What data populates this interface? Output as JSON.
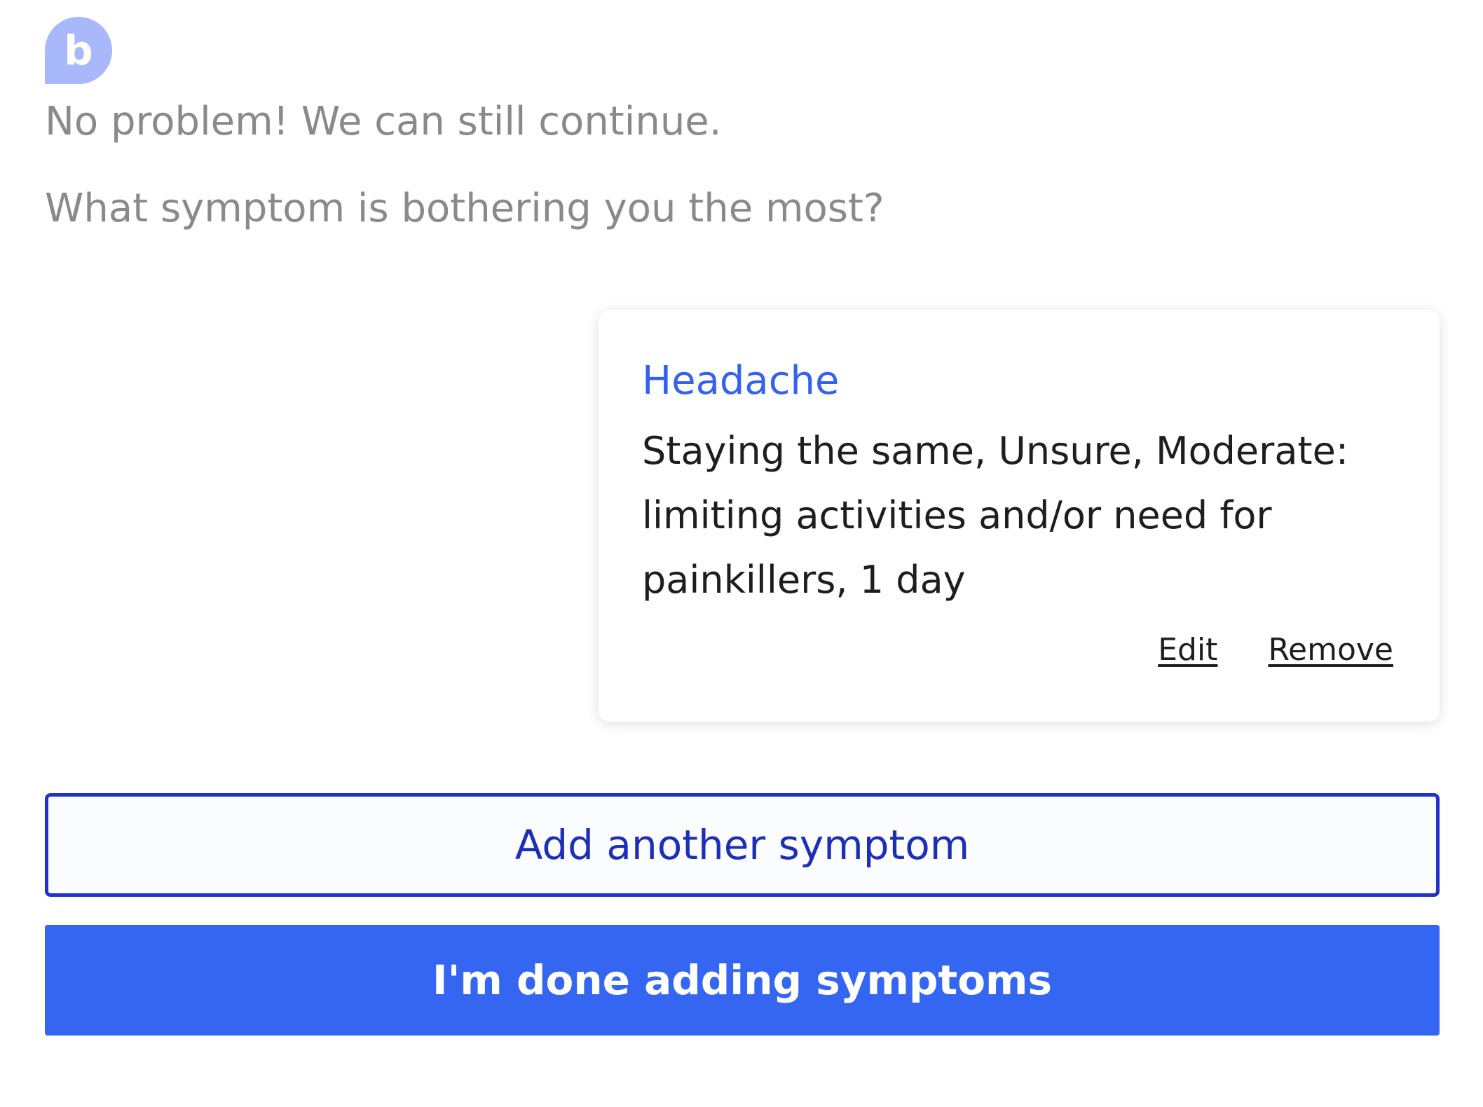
{
  "bot": {
    "avatar_letter": "b",
    "messages": [
      "No problem! We can still continue.",
      "What symptom is bothering you the most?"
    ]
  },
  "symptom_card": {
    "title": "Headache",
    "details": "Staying the same, Unsure, Moderate: limiting activities and/or need for painkillers, 1 day",
    "edit_label": "Edit",
    "remove_label": "Remove"
  },
  "actions": {
    "add_label": "Add another symptom",
    "done_label": "I'm done adding symptoms"
  },
  "colors": {
    "accent": "#3466f2",
    "outline": "#1d33c9",
    "avatar": "#a9b8fb",
    "bot_text": "#8a8a8a"
  }
}
